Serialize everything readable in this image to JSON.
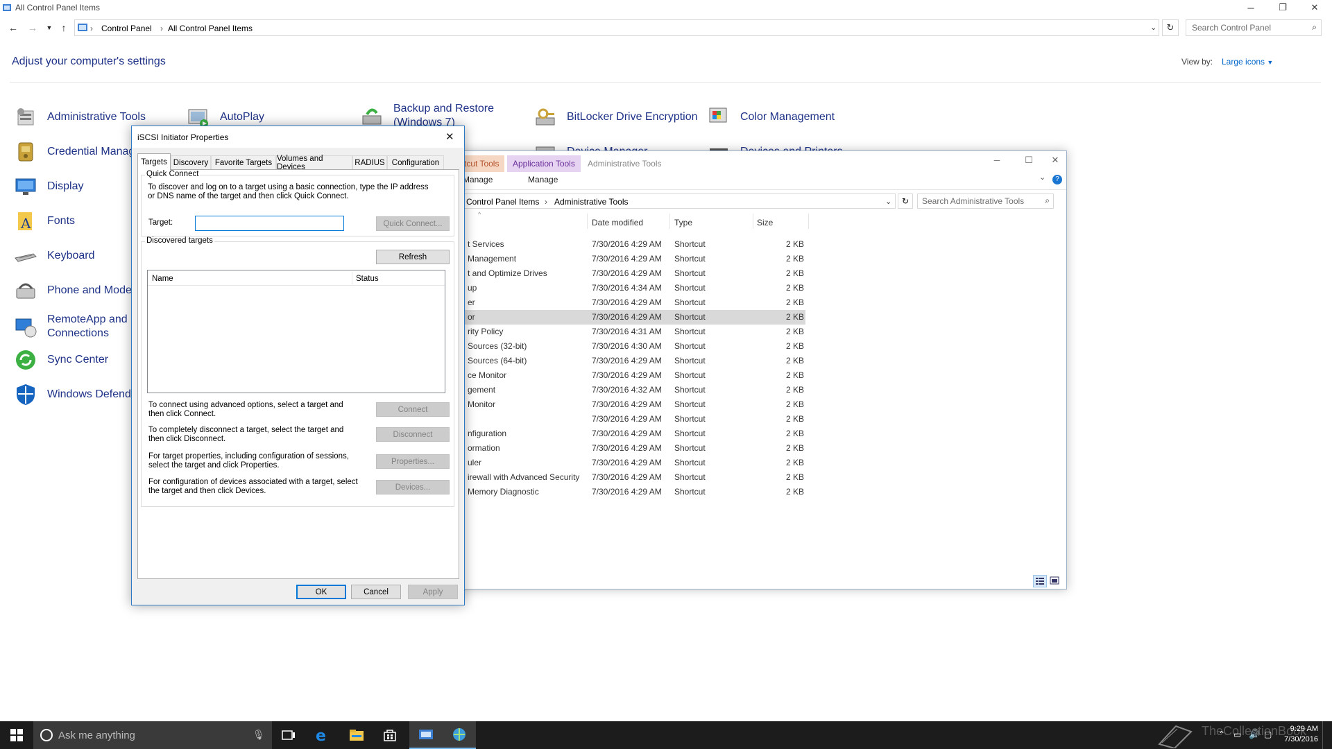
{
  "window": {
    "title": "All Control Panel Items",
    "breadcrumb": [
      "Control Panel",
      "All Control Panel Items"
    ],
    "search_placeholder": "Search Control Panel",
    "heading": "Adjust your computer's settings",
    "view_by_label": "View by:",
    "view_by_value": "Large icons"
  },
  "cp_items": [
    {
      "label": "Administrative Tools",
      "icon": "admin-tools-icon"
    },
    {
      "label": "AutoPlay",
      "icon": "autoplay-icon"
    },
    {
      "label": "Backup and Restore (Windows 7)",
      "icon": "backup-icon"
    },
    {
      "label": "BitLocker Drive Encryption",
      "icon": "bitlocker-icon"
    },
    {
      "label": "Color Management",
      "icon": "color-management-icon"
    },
    {
      "label": "Credential Manage",
      "icon": "credential-manager-icon"
    },
    {
      "label": "Device Manager",
      "icon": "device-manager-icon"
    },
    {
      "label": "Devices and Printers",
      "icon": "devices-printers-icon"
    },
    {
      "label": "Display",
      "icon": "display-icon"
    },
    {
      "label": "Fonts",
      "icon": "fonts-icon"
    },
    {
      "label": "Keyboard",
      "icon": "keyboard-icon"
    },
    {
      "label": "Phone and Modem",
      "icon": "phone-modem-icon"
    },
    {
      "label": "RemoteApp and D",
      "label2": "Connections",
      "icon": "remoteapp-icon"
    },
    {
      "label": "Sync Center",
      "icon": "sync-center-icon"
    },
    {
      "label": "Windows Defende",
      "icon": "windows-defender-icon"
    }
  ],
  "explorer": {
    "title": "Administrative Tools",
    "ribbon_tabs": [
      "rtcut Tools",
      "Application Tools"
    ],
    "ribbon_sub": [
      "Manage",
      "Manage"
    ],
    "breadcrumb": [
      "Control Panel Items",
      "Administrative Tools"
    ],
    "search_placeholder": "Search Administrative Tools",
    "columns": [
      "Date modified",
      "Type",
      "Size"
    ],
    "files": [
      {
        "name": "t Services",
        "date": "7/30/2016 4:29 AM",
        "type": "Shortcut",
        "size": "2 KB"
      },
      {
        "name": "Management",
        "date": "7/30/2016 4:29 AM",
        "type": "Shortcut",
        "size": "2 KB"
      },
      {
        "name": "t and Optimize Drives",
        "date": "7/30/2016 4:29 AM",
        "type": "Shortcut",
        "size": "2 KB"
      },
      {
        "name": "up",
        "date": "7/30/2016 4:34 AM",
        "type": "Shortcut",
        "size": "2 KB"
      },
      {
        "name": "er",
        "date": "7/30/2016 4:29 AM",
        "type": "Shortcut",
        "size": "2 KB"
      },
      {
        "name": "or",
        "date": "7/30/2016 4:29 AM",
        "type": "Shortcut",
        "size": "2 KB",
        "selected": true
      },
      {
        "name": "rity Policy",
        "date": "7/30/2016 4:31 AM",
        "type": "Shortcut",
        "size": "2 KB"
      },
      {
        "name": "Sources (32-bit)",
        "date": "7/30/2016 4:30 AM",
        "type": "Shortcut",
        "size": "2 KB"
      },
      {
        "name": "Sources (64-bit)",
        "date": "7/30/2016 4:29 AM",
        "type": "Shortcut",
        "size": "2 KB"
      },
      {
        "name": "ce Monitor",
        "date": "7/30/2016 4:29 AM",
        "type": "Shortcut",
        "size": "2 KB"
      },
      {
        "name": "gement",
        "date": "7/30/2016 4:32 AM",
        "type": "Shortcut",
        "size": "2 KB"
      },
      {
        "name": "Monitor",
        "date": "7/30/2016 4:29 AM",
        "type": "Shortcut",
        "size": "2 KB"
      },
      {
        "name": "",
        "date": "7/30/2016 4:29 AM",
        "type": "Shortcut",
        "size": "2 KB"
      },
      {
        "name": "nfiguration",
        "date": "7/30/2016 4:29 AM",
        "type": "Shortcut",
        "size": "2 KB"
      },
      {
        "name": "ormation",
        "date": "7/30/2016 4:29 AM",
        "type": "Shortcut",
        "size": "2 KB"
      },
      {
        "name": "uler",
        "date": "7/30/2016 4:29 AM",
        "type": "Shortcut",
        "size": "2 KB"
      },
      {
        "name": "irewall with Advanced Security",
        "date": "7/30/2016 4:29 AM",
        "type": "Shortcut",
        "size": "2 KB"
      },
      {
        "name": "Memory Diagnostic",
        "date": "7/30/2016 4:29 AM",
        "type": "Shortcut",
        "size": "2 KB"
      }
    ]
  },
  "dialog": {
    "title": "iSCSI Initiator Properties",
    "tabs": [
      "Targets",
      "Discovery",
      "Favorite Targets",
      "Volumes and Devices",
      "RADIUS",
      "Configuration"
    ],
    "quick_connect": {
      "group_label": "Quick Connect",
      "description": "To discover and log on to a target using a basic connection, type the IP address or DNS name of the target and then click Quick Connect.",
      "target_label": "Target:",
      "target_value": "",
      "button": "Quick Connect..."
    },
    "discovered": {
      "group_label": "Discovered targets",
      "refresh_button": "Refresh",
      "columns": [
        "Name",
        "Status"
      ]
    },
    "actions": [
      {
        "text": "To connect using advanced options, select a target and then click Connect.",
        "button": "Connect"
      },
      {
        "text": "To completely disconnect a target, select the target and then click Disconnect.",
        "button": "Disconnect"
      },
      {
        "text": "For target properties, including configuration of sessions, select the target and click Properties.",
        "button": "Properties..."
      },
      {
        "text": "For configuration of devices associated with a target, select the target and then click Devices.",
        "button": "Devices..."
      }
    ],
    "footer": {
      "ok": "OK",
      "cancel": "Cancel",
      "apply": "Apply"
    }
  },
  "taskbar": {
    "search_placeholder": "Ask me anything",
    "time": "9:29 AM",
    "date": "7/30/2016",
    "watermark": "TheCollectionBook"
  },
  "colors": {
    "link_blue": "#1e3287",
    "accent": "#0078d7",
    "taskbar": "#1c1c1c",
    "selected_row": "#d9d9d9"
  }
}
